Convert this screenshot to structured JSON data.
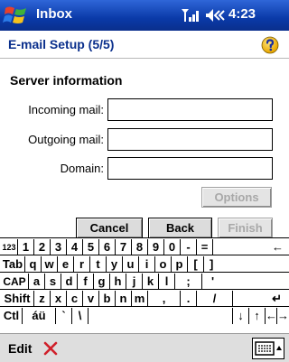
{
  "titlebar": {
    "app_title": "Inbox",
    "time": "4:23"
  },
  "header": {
    "title": "E-mail Setup (5/5)"
  },
  "form": {
    "section_title": "Server information",
    "incoming_label": "Incoming mail:",
    "incoming_value": "",
    "outgoing_label": "Outgoing mail:",
    "outgoing_value": "",
    "domain_label": "Domain:",
    "domain_value": ""
  },
  "buttons": {
    "options": "Options",
    "cancel": "Cancel",
    "back": "Back",
    "finish": "Finish"
  },
  "keyboard": {
    "rows": [
      [
        "123",
        "1",
        "2",
        "3",
        "4",
        "5",
        "6",
        "7",
        "8",
        "9",
        "0",
        "-",
        "=",
        "←"
      ],
      [
        "Tab",
        "q",
        "w",
        "e",
        "r",
        "t",
        "y",
        "u",
        "i",
        "o",
        "p",
        "[",
        "]"
      ],
      [
        "CAP",
        "a",
        "s",
        "d",
        "f",
        "g",
        "h",
        "j",
        "k",
        "l",
        ";",
        "'"
      ],
      [
        "Shift",
        "z",
        "x",
        "c",
        "v",
        "b",
        "n",
        "m",
        ",",
        ".",
        "/",
        "↵"
      ],
      [
        "Ctl",
        "áü",
        "`",
        "\\",
        "",
        "↓",
        "↑",
        "←",
        "→"
      ]
    ]
  },
  "menubar": {
    "edit": "Edit"
  },
  "icons": {
    "start": "windows-flag-icon",
    "signal": "signal-strength-icon",
    "volume": "speaker-icon",
    "help": "help-icon",
    "delete": "red-x-delete-icon",
    "sip": "keyboard-input-icon"
  },
  "colors": {
    "titlebar": "#0a3aa8",
    "header_text": "#0a2f8c",
    "delete_x": "#d0202a"
  }
}
